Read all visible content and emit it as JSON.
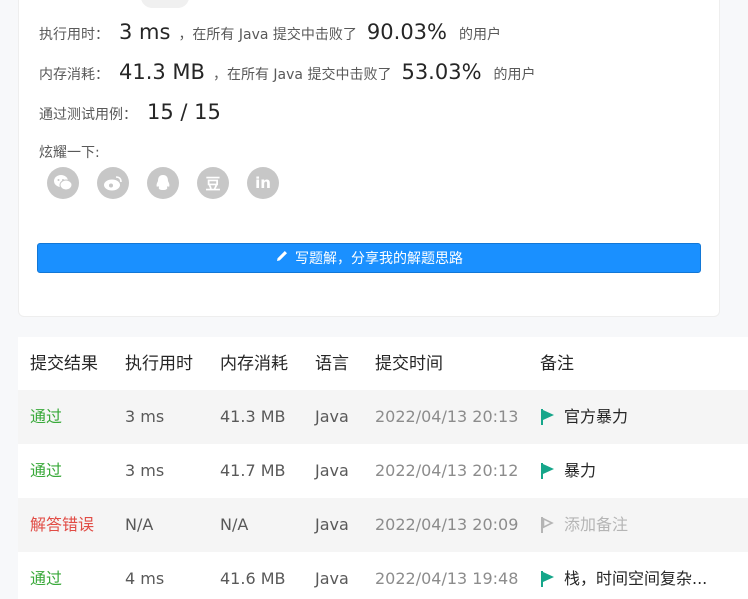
{
  "stats": {
    "runtime": {
      "label": "执行用时：",
      "value": "3 ms",
      "text": "，在所有 Java 提交中击败了",
      "percent": "90.03%",
      "suffix": "的用户"
    },
    "memory": {
      "label": "内存消耗：",
      "value": "41.3 MB",
      "text": "，在所有 Java 提交中击败了",
      "percent": "53.03%",
      "suffix": "的用户"
    },
    "tests": {
      "label": "通过测试用例：",
      "value": "15 / 15"
    }
  },
  "share": {
    "label": "炫耀一下:",
    "icons": [
      "wechat-icon",
      "weibo-icon",
      "qq-icon",
      "douban-icon",
      "linkedin-icon"
    ],
    "glyphs": {
      "douban": "豆",
      "linkedin": "in"
    }
  },
  "write_button": {
    "label": "写题解，分享我的解题思路"
  },
  "table": {
    "headers": [
      "提交结果",
      "执行用时",
      "内存消耗",
      "语言",
      "提交时间",
      "备注"
    ],
    "rows": [
      {
        "result": "通过",
        "status": "ok",
        "time": "3 ms",
        "memory": "41.3 MB",
        "lang": "Java",
        "submitted": "2022/04/13 20:13",
        "note": "官方暴力",
        "note_set": true
      },
      {
        "result": "通过",
        "status": "ok",
        "time": "3 ms",
        "memory": "41.7 MB",
        "lang": "Java",
        "submitted": "2022/04/13 20:12",
        "note": "暴力",
        "note_set": true
      },
      {
        "result": "解答错误",
        "status": "err",
        "time": "N/A",
        "memory": "N/A",
        "lang": "Java",
        "submitted": "2022/04/13 20:09",
        "note": "添加备注",
        "note_set": false
      },
      {
        "result": "通过",
        "status": "ok",
        "time": "4 ms",
        "memory": "41.6 MB",
        "lang": "Java",
        "submitted": "2022/04/13 19:48",
        "note": "栈，时间空间复杂...",
        "note_set": true
      }
    ]
  },
  "colors": {
    "accent": "#1a90ff",
    "success": "#39a93a",
    "error": "#e14c45",
    "flag": "#16a68a",
    "flag_empty": "#b5b5b5"
  }
}
